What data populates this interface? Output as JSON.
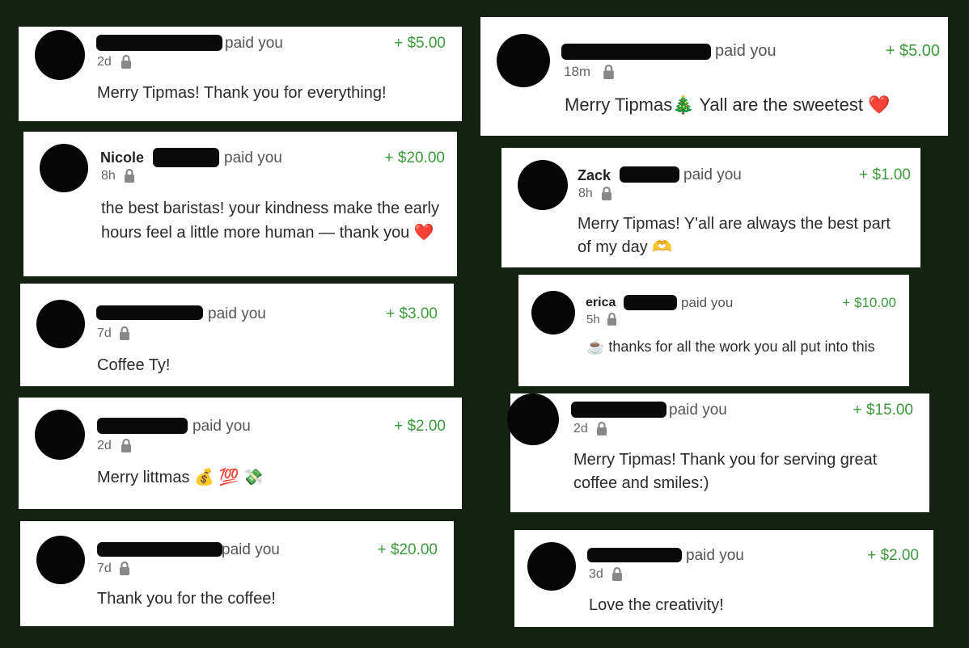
{
  "accent_color": "#3c9a3c",
  "background_color": "#142211",
  "paid_label": "paid you",
  "cards": [
    {
      "name": "",
      "amount": "+ $5.00",
      "time": "2d",
      "message": "Merry Tipmas! Thank you for everything!"
    },
    {
      "name": "Nicole",
      "amount": "+ $20.00",
      "time": "8h",
      "message": "the best baristas! your kindness make the early hours feel a little more human — thank you ❤️"
    },
    {
      "name": "",
      "amount": "+ $3.00",
      "time": "7d",
      "message": "Coffee Ty!"
    },
    {
      "name": "",
      "amount": "+ $2.00",
      "time": "2d",
      "message": "Merry littmas 💰 💯 💸"
    },
    {
      "name": "",
      "amount": "+ $20.00",
      "time": "7d",
      "message": "Thank you for the coffee!"
    },
    {
      "name": "",
      "amount": "+ $5.00",
      "time": "18m",
      "message": "Merry Tipmas🎄 Yall are the sweetest ❤️"
    },
    {
      "name": "Zack",
      "amount": "+ $1.00",
      "time": "8h",
      "message": "Merry Tipmas! Y'all are always the best part of my day 🫶"
    },
    {
      "name": "erica",
      "amount": "+ $10.00",
      "time": "5h",
      "message": "☕ thanks for all the work you all put into this"
    },
    {
      "name": "",
      "amount": "+ $15.00",
      "time": "2d",
      "message": "Merry Tipmas! Thank you for serving great coffee and smiles:)"
    },
    {
      "name": "",
      "amount": "+ $2.00",
      "time": "3d",
      "message": "Love the creativity!"
    }
  ]
}
